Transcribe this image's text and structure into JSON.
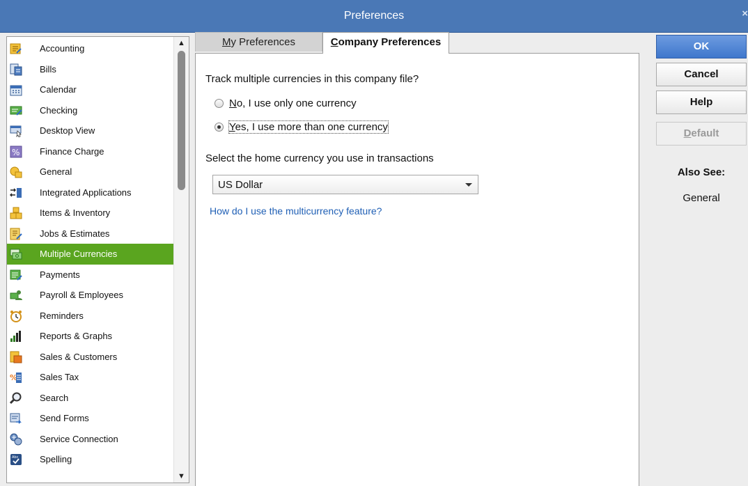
{
  "window": {
    "title": "Preferences",
    "close_glyph": "×"
  },
  "sidebar": {
    "items": [
      {
        "label": "Accounting",
        "icon": "accounting-icon"
      },
      {
        "label": "Bills",
        "icon": "bills-icon"
      },
      {
        "label": "Calendar",
        "icon": "calendar-icon"
      },
      {
        "label": "Checking",
        "icon": "checking-icon"
      },
      {
        "label": "Desktop View",
        "icon": "desktop-view-icon"
      },
      {
        "label": "Finance Charge",
        "icon": "finance-charge-icon"
      },
      {
        "label": "General",
        "icon": "general-icon"
      },
      {
        "label": "Integrated Applications",
        "icon": "integrated-applications-icon"
      },
      {
        "label": "Items & Inventory",
        "icon": "items-inventory-icon"
      },
      {
        "label": "Jobs & Estimates",
        "icon": "jobs-estimates-icon"
      },
      {
        "label": "Multiple Currencies",
        "icon": "multiple-currencies-icon",
        "selected": true
      },
      {
        "label": "Payments",
        "icon": "payments-icon"
      },
      {
        "label": "Payroll & Employees",
        "icon": "payroll-employees-icon"
      },
      {
        "label": "Reminders",
        "icon": "reminders-icon"
      },
      {
        "label": "Reports & Graphs",
        "icon": "reports-graphs-icon"
      },
      {
        "label": "Sales & Customers",
        "icon": "sales-customers-icon"
      },
      {
        "label": "Sales Tax",
        "icon": "sales-tax-icon"
      },
      {
        "label": "Search",
        "icon": "search-icon"
      },
      {
        "label": "Send Forms",
        "icon": "send-forms-icon"
      },
      {
        "label": "Service Connection",
        "icon": "service-connection-icon"
      },
      {
        "label": "Spelling",
        "icon": "spelling-icon"
      }
    ]
  },
  "tabs": {
    "my": {
      "accel": "M",
      "rest": "y Preferences"
    },
    "company": {
      "accel": "C",
      "rest": "ompany Preferences"
    }
  },
  "content": {
    "question": "Track multiple currencies in this company file?",
    "option_no": {
      "accel": "N",
      "rest": "o, I use only one currency",
      "checked": false
    },
    "option_yes": {
      "accel": "Y",
      "rest": "es, I use more than one currency",
      "checked": true
    },
    "home_currency_label": "Select the home currency you use in transactions",
    "home_currency_value": "US Dollar",
    "help_link": "How do I use the multicurrency feature?"
  },
  "buttons": {
    "ok": "OK",
    "cancel": "Cancel",
    "help": "Help",
    "default_accel": "D",
    "default_rest": "efault"
  },
  "also_see": {
    "heading": "Also See:",
    "items": [
      "General"
    ]
  },
  "colors": {
    "titlebar": "#4a78b6",
    "selected": "#5aa51f",
    "link": "#1f5fb5",
    "ok_button": "#3f77cc"
  }
}
